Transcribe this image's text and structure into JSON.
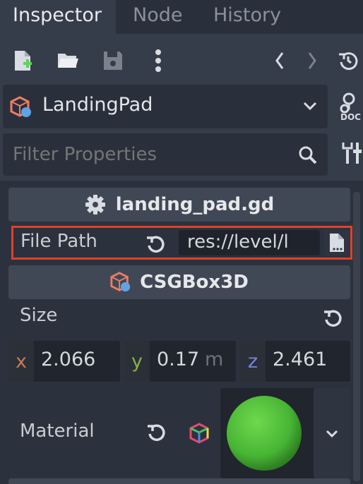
{
  "tabs": [
    "Inspector",
    "Node",
    "History"
  ],
  "object_selector": {
    "name": "LandingPad"
  },
  "filter": {
    "placeholder": "Filter Properties"
  },
  "script_section": {
    "title": "landing_pad.gd"
  },
  "file_path": {
    "label": "File Path",
    "value": "res://level/l"
  },
  "csg_section": {
    "title": "CSGBox3D"
  },
  "size": {
    "label": "Size",
    "x_label": "x",
    "x_value": "2.066",
    "y_label": "y",
    "y_value": "0.17",
    "y_unit": "m",
    "z_label": "z",
    "z_value": "2.461"
  },
  "material": {
    "label": "Material",
    "preview_color": "#4fc23a"
  },
  "colors": {
    "highlight_box": "#e0412b",
    "x_axis": "#c87a55",
    "y_axis": "#8ab04a",
    "z_axis": "#7a82d6"
  },
  "icons": [
    "new-script-icon",
    "open-folder-icon",
    "save-icon",
    "more-vertical-icon",
    "back-icon",
    "forward-icon",
    "history-icon",
    "csg-icon",
    "chevron-down-icon",
    "search-icon",
    "node-docs-icon",
    "tools-icon",
    "gear-icon",
    "revert-icon",
    "file-icon",
    "cube-rgb-icon"
  ]
}
